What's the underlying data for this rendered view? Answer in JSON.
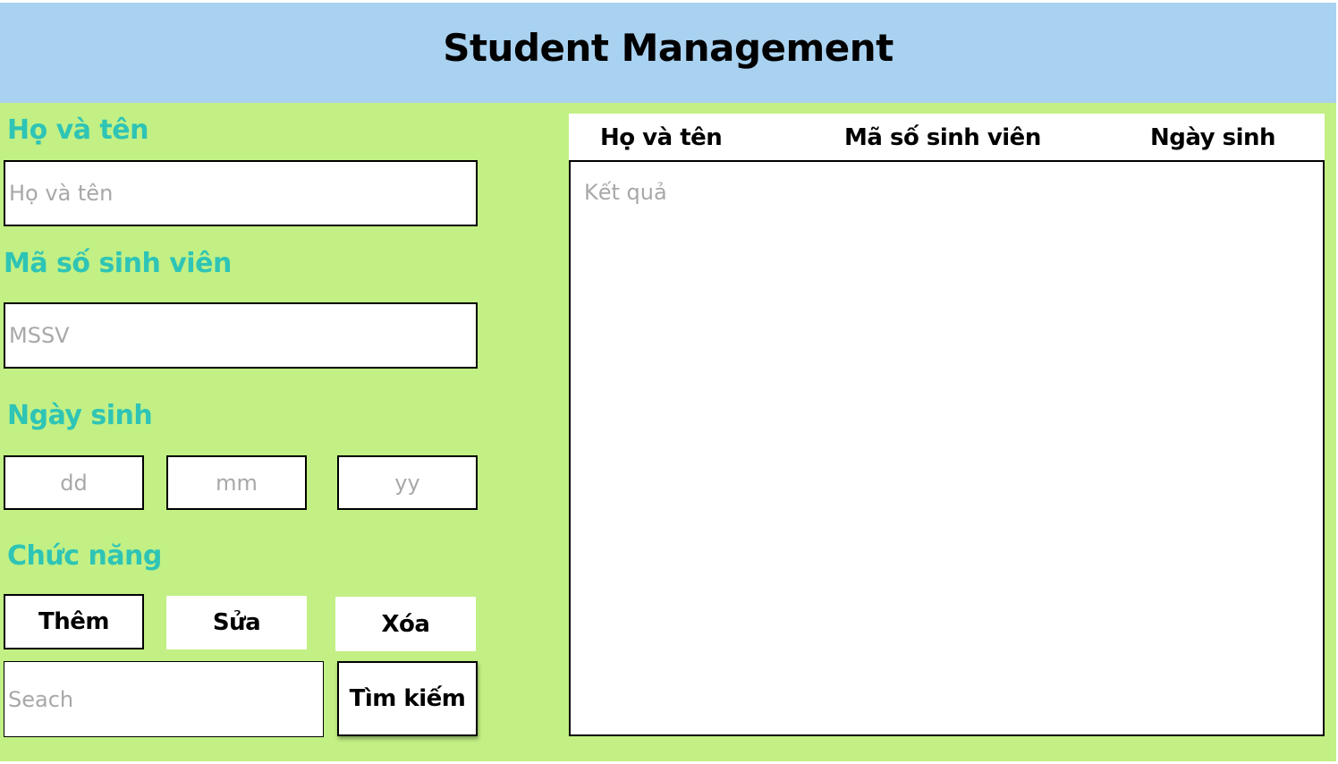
{
  "header": {
    "title": "Student Management"
  },
  "form": {
    "name_label": "Họ và tên",
    "name_placeholder": "Họ và tên",
    "id_label": "Mã số sinh viên",
    "id_placeholder": "MSSV",
    "dob_label": "Ngày sinh",
    "dob_day_placeholder": "dd",
    "dob_month_placeholder": "mm",
    "dob_year_placeholder": "yy",
    "functions_label": "Chức năng",
    "add_label": "Thêm",
    "edit_label": "Sửa",
    "delete_label": "Xóa",
    "search_placeholder": "Seach",
    "search_button_label": "Tìm kiếm"
  },
  "results": {
    "columns": [
      "Họ và tên",
      "Mã số sinh viên",
      "Ngày sinh"
    ],
    "placeholder": "Kết quả"
  },
  "colors": {
    "header_bg": "#a9d1f0",
    "main_bg": "#c2f084",
    "label_color": "#2ec4b6"
  }
}
